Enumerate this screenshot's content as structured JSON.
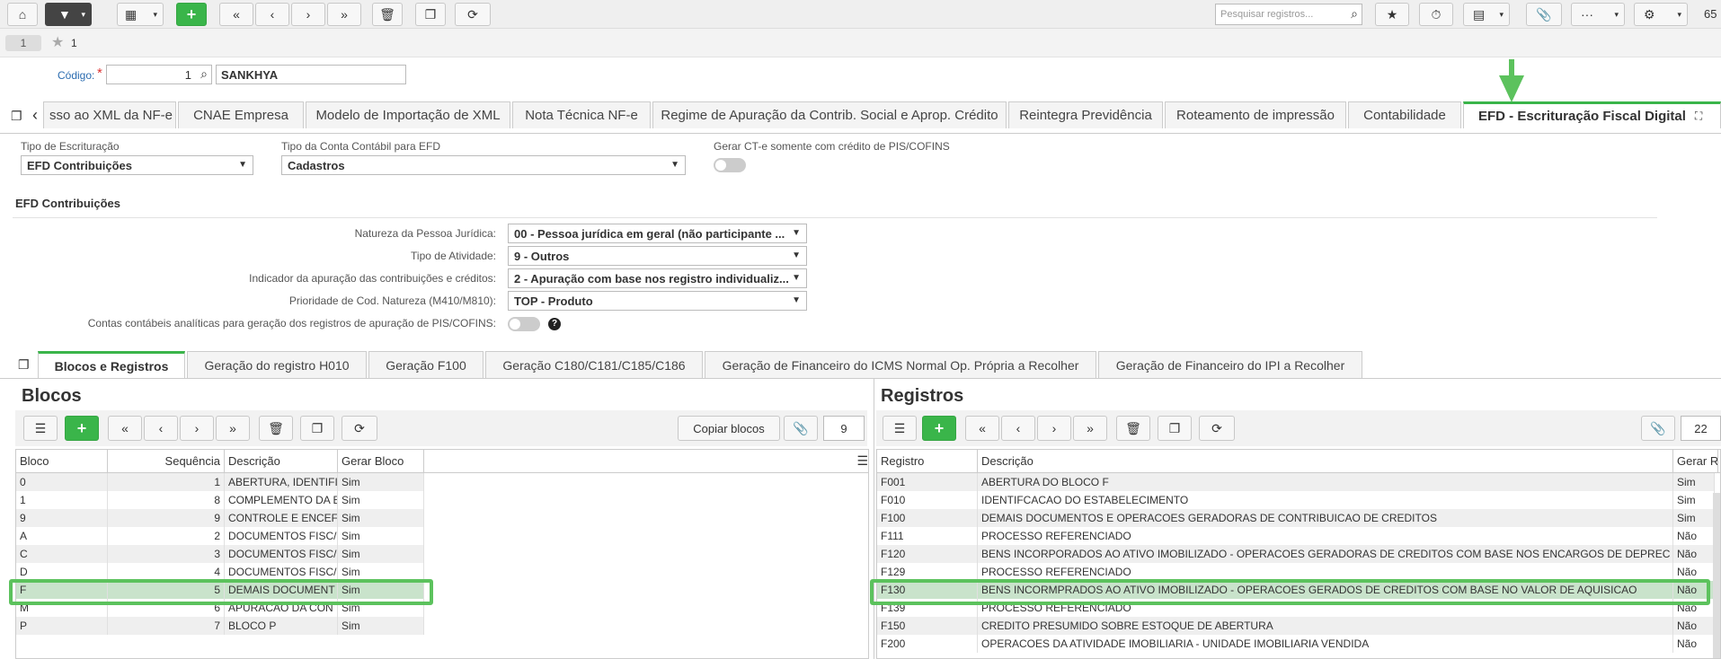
{
  "toolbar": {
    "search_placeholder": "Pesquisar registros...",
    "page_value": "65"
  },
  "breadcrumb": {
    "page": "1",
    "star_count": "1"
  },
  "codigo": {
    "label": "Código:",
    "required_mark": "*",
    "value": "1",
    "name": "SANKHYA"
  },
  "main_tabs": [
    "sso ao XML da NF-e",
    "CNAE Empresa",
    "Modelo de Importação de XML",
    "Nota Técnica NF-e",
    "Regime de Apuração da Contrib. Social e Aprop. Crédito",
    "Reintegra Previdência",
    "Roteamento de impressão",
    "Contabilidade",
    "EFD - Escrituração Fiscal Digital"
  ],
  "form": {
    "tipo_escrituracao_label": "Tipo de Escrituração",
    "tipo_escrituracao_value": "EFD Contribuições",
    "tipo_conta_label": "Tipo da Conta Contábil para EFD",
    "tipo_conta_value": "Cadastros",
    "gerar_cte_label": "Gerar CT-e somente com crédito de PIS/COFINS",
    "section_title": "EFD Contribuições",
    "natureza_label": "Natureza da Pessoa Jurídica:",
    "natureza_value": "00 - Pessoa jurídica em geral (não participante ...",
    "atividade_label": "Tipo de Atividade:",
    "atividade_value": "9 - Outros",
    "indicador_label": "Indicador da apuração das contribuições e créditos:",
    "indicador_value": "2 - Apuração com base nos registro individualiz...",
    "prioridade_label": "Prioridade de Cod. Natureza (M410/M810):",
    "prioridade_value": "TOP - Produto",
    "contas_label": "Contas contábeis analíticas para geração dos registros de apuração de PIS/COFINS:"
  },
  "sub_tabs": [
    "Blocos e Registros",
    "Geração do registro H010",
    "Geração F100",
    "Geração C180/C181/C185/C186",
    "Geração de Financeiro do ICMS Normal Op. Própria a Recolher",
    "Geração de Financeiro do IPI a Recolher"
  ],
  "blocos": {
    "title": "Blocos",
    "copy_label": "Copiar blocos",
    "count": "9",
    "columns": [
      "Bloco",
      "Sequência",
      "Descrição",
      "Gerar Bloco"
    ],
    "rows": [
      [
        "0",
        "1",
        "ABERTURA, IDENTIFI",
        "Sim"
      ],
      [
        "1",
        "8",
        "COMPLEMENTO DA E",
        "Sim"
      ],
      [
        "9",
        "9",
        "CONTROLE E ENCEF",
        "Sim"
      ],
      [
        "A",
        "2",
        "DOCUMENTOS FISC/",
        "Sim"
      ],
      [
        "C",
        "3",
        "DOCUMENTOS FISC/",
        "Sim"
      ],
      [
        "D",
        "4",
        "DOCUMENTOS FISC/",
        "Sim"
      ],
      [
        "F",
        "5",
        "DEMAIS DOCUMENT",
        "Sim"
      ],
      [
        "M",
        "6",
        "APURACAO DA CON",
        "Sim"
      ],
      [
        "P",
        "7",
        "BLOCO P",
        "Sim"
      ]
    ]
  },
  "registros": {
    "title": "Registros",
    "count": "22",
    "columns": [
      "Registro",
      "Descrição",
      "Gerar R"
    ],
    "rows": [
      [
        "F001",
        "ABERTURA DO BLOCO F",
        "Sim"
      ],
      [
        "F010",
        "IDENTIFCACAO DO ESTABELECIMENTO",
        "Sim"
      ],
      [
        "F100",
        "DEMAIS DOCUMENTOS E OPERACOES GERADORAS DE CONTRIBUICAO DE CREDITOS",
        "Sim"
      ],
      [
        "F111",
        "PROCESSO REFERENCIADO",
        "Não"
      ],
      [
        "F120",
        "BENS INCORPORADOS AO ATIVO IMOBILIZADO - OPERACOES GERADORAS DE CREDITOS COM BASE NOS ENCARGOS DE DEPREC",
        "Não"
      ],
      [
        "F129",
        "PROCESSO REFERENCIADO",
        "Não"
      ],
      [
        "F130",
        "BENS INCORMPRADOS AO ATIVO IMOBILIZADO - OPERACOES GERADOS DE CREDITOS COM BASE NO VALOR DE AQUISICAO",
        "Não"
      ],
      [
        "F139",
        "PROCESSO REFERENCIADO",
        "Não"
      ],
      [
        "F150",
        "CREDITO PRESUMIDO SOBRE ESTOQUE DE ABERTURA",
        "Não"
      ],
      [
        "F200",
        "OPERACOES DA ATIVIDADE IMOBILIARIA - UNIDADE IMOBILIARIA VENDIDA",
        "Não"
      ]
    ]
  }
}
